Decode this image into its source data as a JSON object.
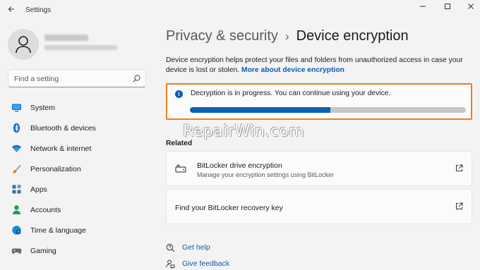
{
  "window": {
    "app_title": "Settings",
    "back_icon": "back-arrow-icon",
    "controls": [
      "minimize-icon",
      "maximize-icon",
      "close-icon"
    ]
  },
  "user": {
    "avatar_icon": "person-icon"
  },
  "search": {
    "placeholder": "Find a setting",
    "icon": "search-icon"
  },
  "sidebar": {
    "items": [
      {
        "label": "System",
        "icon": "monitor-icon",
        "color": "#0078d4"
      },
      {
        "label": "Bluetooth & devices",
        "icon": "bluetooth-icon",
        "color": "#0078d4"
      },
      {
        "label": "Network & internet",
        "icon": "wifi-icon",
        "color": "#1a73c8"
      },
      {
        "label": "Personalization",
        "icon": "brush-icon",
        "color": "#d9772a"
      },
      {
        "label": "Apps",
        "icon": "apps-icon",
        "color": "#3c6ea5"
      },
      {
        "label": "Accounts",
        "icon": "person-icon",
        "color": "#19a05a"
      },
      {
        "label": "Time & language",
        "icon": "globe-clock-icon",
        "color": "#1a8ad6"
      },
      {
        "label": "Gaming",
        "icon": "gamepad-icon",
        "color": "#6b6b6b"
      }
    ]
  },
  "main": {
    "breadcrumb_parent": "Privacy & security",
    "breadcrumb_sep": "›",
    "breadcrumb_current": "Device encryption",
    "description": "Device encryption helps protect your files and folders from unauthorized access in case your device is lost or stolen.",
    "description_link": "More about device encryption",
    "status_message": "Decryption is in progress. You can continue using your device.",
    "progress_fraction": 0.51,
    "watermark": "RepairWin.com",
    "related_header": "Related",
    "related": [
      {
        "title": "BitLocker drive encryption",
        "subtitle": "Manage your encryption settings using BitLocker",
        "icon": "drive-lock-icon"
      },
      {
        "title": "Find your BitLocker recovery key",
        "subtitle": "",
        "icon": ""
      }
    ],
    "help_links": [
      {
        "label": "Get help",
        "icon": "help-chat-icon"
      },
      {
        "label": "Give feedback",
        "icon": "feedback-icon"
      }
    ]
  },
  "colors": {
    "accent": "#0b5cad",
    "highlight_border": "#e8801c",
    "progress_fill": "#0b61b6",
    "progress_track": "#c6c6c6"
  }
}
